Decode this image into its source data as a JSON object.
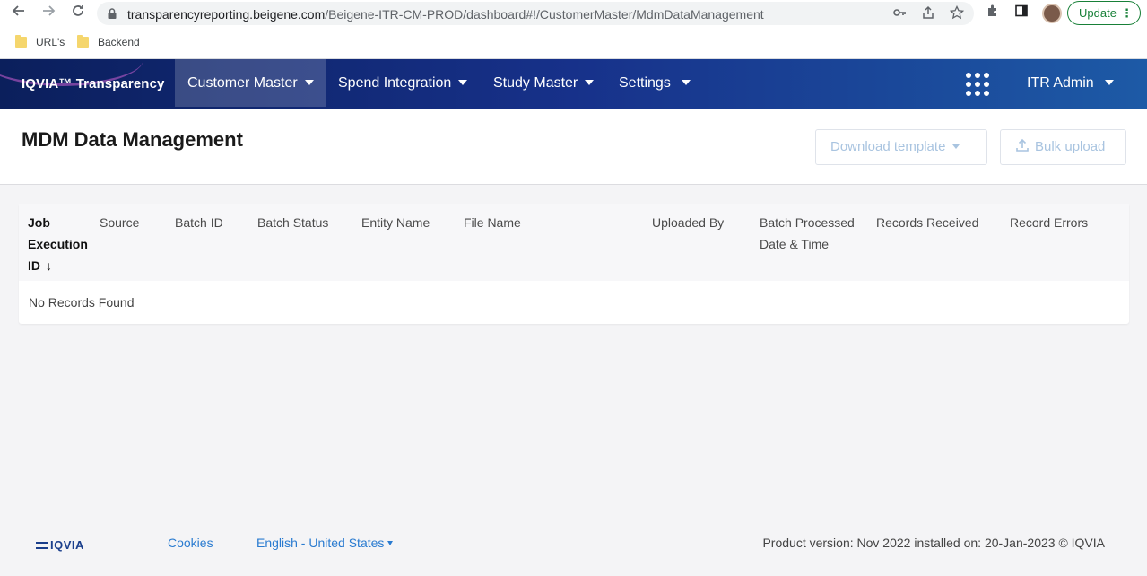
{
  "browser": {
    "url_host": "transparencyreporting.beigene.com",
    "url_path": "/Beigene-ITR-CM-PROD/dashboard#!/CustomerMaster/MdmDataManagement",
    "update_label": "Update",
    "icons": [
      "back-arrow-icon",
      "forward-arrow-icon",
      "reload-icon",
      "lock-icon",
      "key-icon",
      "share-icon",
      "star-icon",
      "puzzle-icon",
      "sidepanel-icon",
      "menu-dots-icon"
    ]
  },
  "bookmarks": [
    {
      "label": "URL's"
    },
    {
      "label": "Backend"
    }
  ],
  "nav": {
    "brand": "IQVIA™ Transparency",
    "items": [
      {
        "label": "Customer Master"
      },
      {
        "label": "Spend Integration"
      },
      {
        "label": "Study Master"
      },
      {
        "label": "Settings"
      }
    ],
    "user": "ITR Admin"
  },
  "page": {
    "title": "MDM Data Management",
    "download_template": "Download template",
    "bulk_upload": "Bulk upload"
  },
  "table": {
    "columns": [
      {
        "line1": "Job",
        "line2": "Execution",
        "line3": "ID"
      },
      {
        "line1": "Source"
      },
      {
        "line1": "Batch ID"
      },
      {
        "line1": "Batch Status"
      },
      {
        "line1": "Entity Name"
      },
      {
        "line1": "File Name"
      },
      {
        "line1": "Uploaded By"
      },
      {
        "line1": "Batch Processed",
        "line2": "Date & Time"
      },
      {
        "line1": "Records Received"
      },
      {
        "line1": "Record Errors"
      }
    ],
    "sort_indicator": "↓",
    "empty_message": "No Records Found"
  },
  "footer": {
    "logo": "IQVIA",
    "cookies": "Cookies",
    "language": "English - United States",
    "version": "Product version: Nov 2022 installed on: 20-Jan-2023 © IQVIA"
  },
  "colors": {
    "nav_start": "#0b1f5c",
    "nav_end": "#1d5aa6",
    "link": "#2a7bd0",
    "update_green": "#188038"
  }
}
